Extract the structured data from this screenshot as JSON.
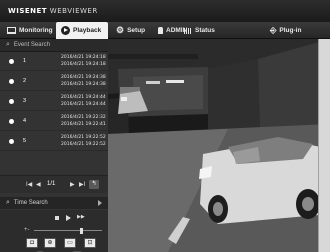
{
  "brand": {
    "name_bold": "WISENET",
    "name_rest": " WEBVIEWER"
  },
  "nav": {
    "monitoring": "Monitoring",
    "playback": "Playback",
    "setup": "Setup",
    "user": "ADMIN",
    "status": "Status",
    "plugin": "Plug-in",
    "icons": [
      "monitor-icon",
      "playback-icon",
      "gear-icon",
      "user-icon",
      "status-bars-icon",
      "plug-icon"
    ]
  },
  "event_search": {
    "label": "Event Search"
  },
  "events": [
    {
      "num": "1",
      "start": "2016/4/21 19:24:18",
      "end": "2016/4/21 19:24:18"
    },
    {
      "num": "2",
      "start": "2016/4/21 19:24:38",
      "end": "2016/4/21 19:24:38"
    },
    {
      "num": "3",
      "start": "2016/4/21 19:24:44",
      "end": "2016/4/21 19:24:44"
    },
    {
      "num": "4",
      "start": "2016/4/21 19:22:32",
      "end": "2016/4/21 19:22:41"
    },
    {
      "num": "5",
      "start": "2016/4/21 19:22:52",
      "end": "2016/4/21 19:22:52"
    }
  ],
  "pager": {
    "first": "I◀",
    "prev": "◀",
    "label": "1/1",
    "next": "▶",
    "last": "▶I",
    "action": "↰"
  },
  "time_search": {
    "label": "Time Search"
  },
  "controls": {
    "step": "▶▶",
    "speed_minus": "+-",
    "speed_value": 0.68
  },
  "tools": {
    "capture": "◘",
    "zoom": "⊕",
    "export": "▭",
    "fit": "⊡"
  },
  "rounds": {
    "info": "i",
    "cam": "◉"
  },
  "colors": {
    "nav_bg": "#2b2b2b",
    "panel_bg": "#333333",
    "active_tab_bg": "#f2f2f2"
  }
}
